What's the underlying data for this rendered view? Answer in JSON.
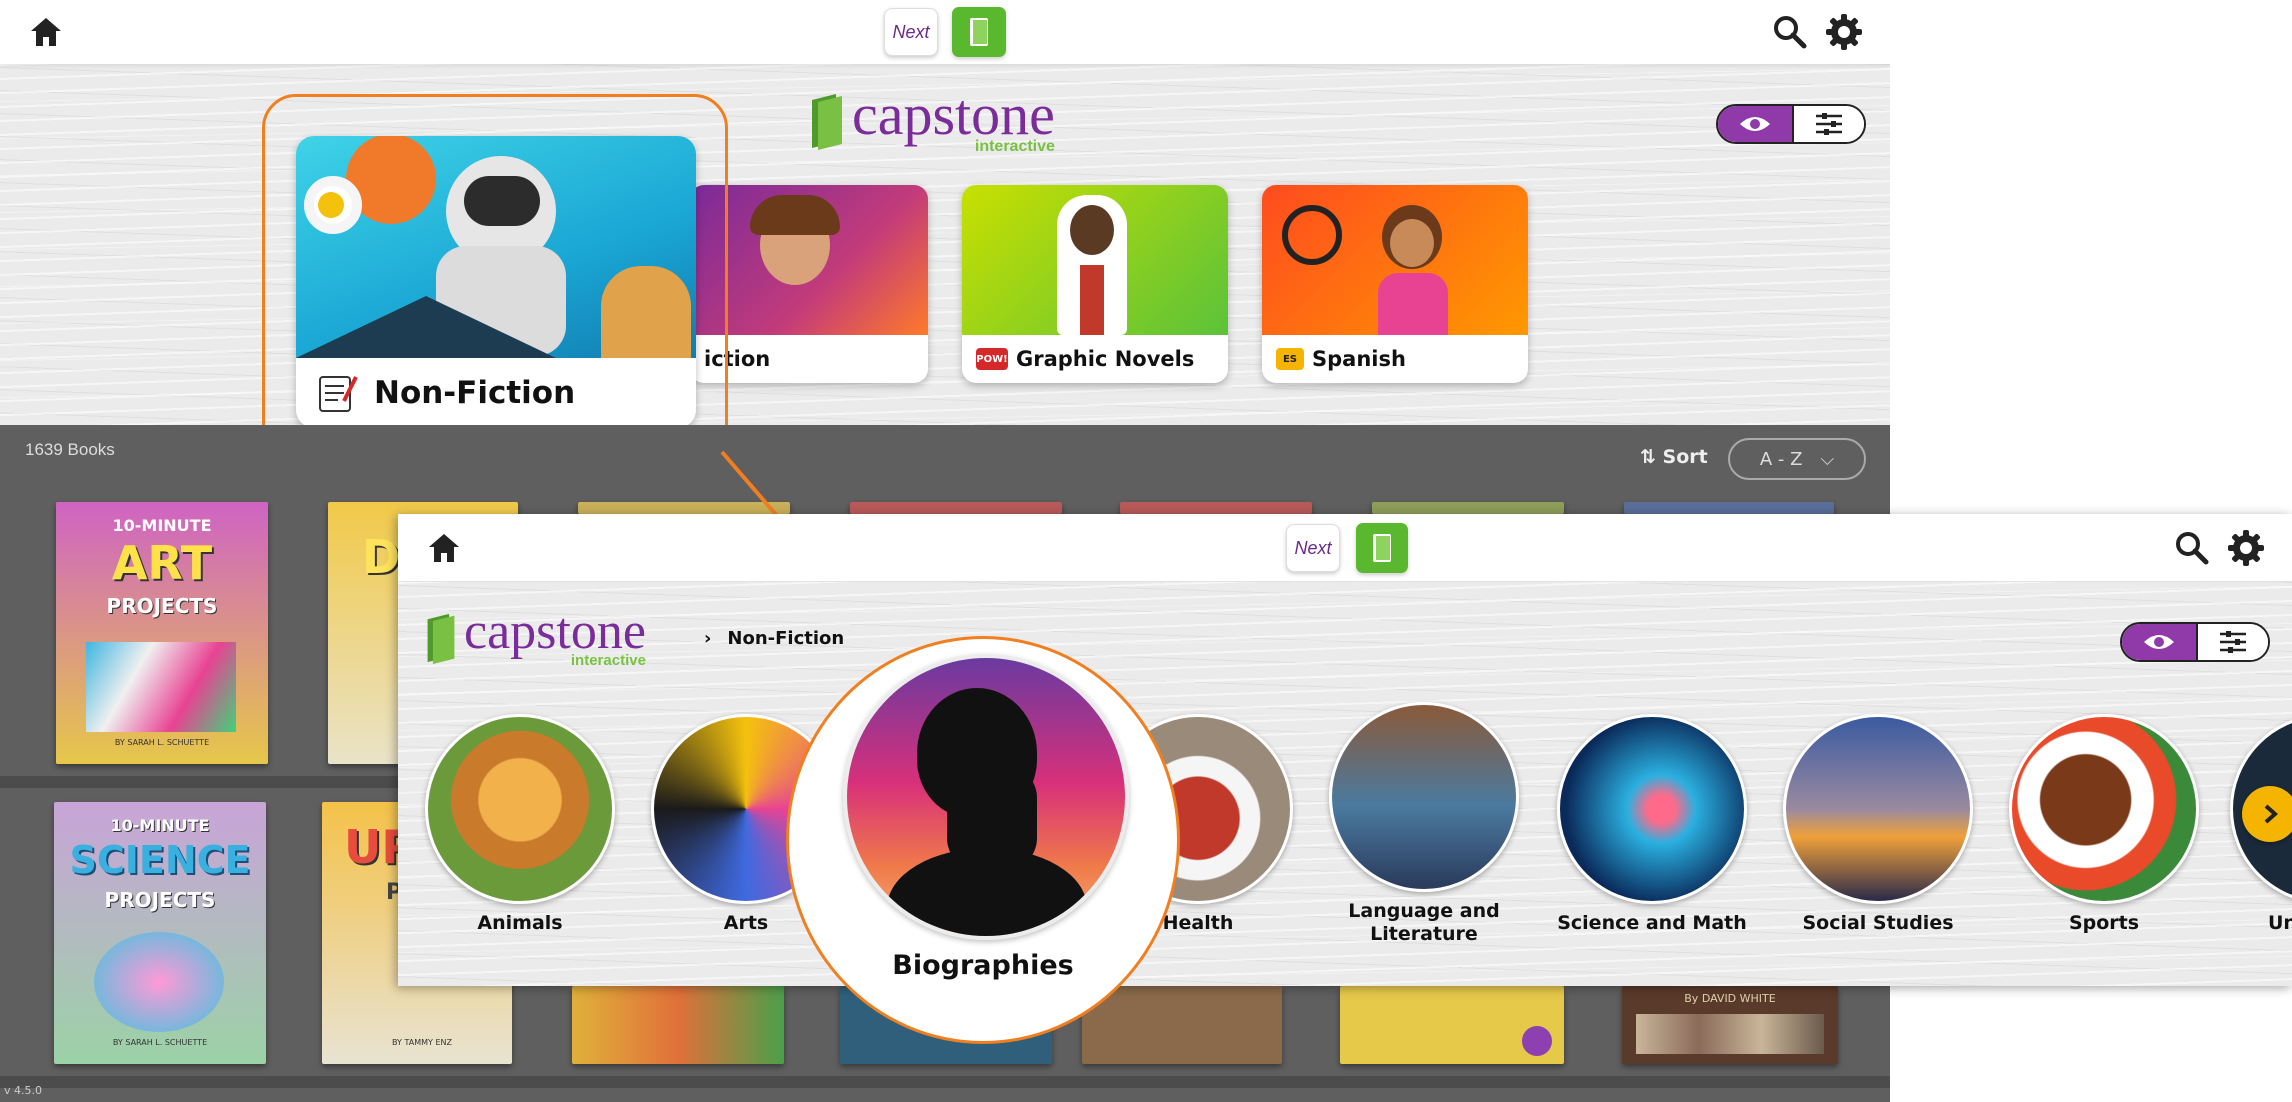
{
  "background_screen": {
    "next_label": "Next",
    "logo": {
      "word": "capstone",
      "sub": "interactive"
    },
    "categories": [
      {
        "label": "Non-Fiction",
        "icon": "scroll-icon"
      },
      {
        "label": "iction",
        "icon": ""
      },
      {
        "label": "Graphic Novels",
        "icon": "pow-badge",
        "badge": "POW!"
      },
      {
        "label": "Spanish",
        "icon": "es-badge",
        "badge": "ES"
      }
    ],
    "book_count": "1639 Books",
    "sort_label": "Sort",
    "sort_value": "A - Z",
    "version": "v 4.5.0",
    "books": [
      {
        "line1": "10-MINUTE",
        "line2": "ART",
        "line3": "PROJECTS",
        "author": "BY SARAH L. SCHUETTE"
      },
      {
        "line1": "10-MINUTE",
        "line2": "SCIENCE",
        "line3": "PROJECTS",
        "author": "BY SARAH L. SCHUETTE"
      },
      {
        "line1": "",
        "line2": "DR",
        "line3": "P"
      },
      {
        "line1": "",
        "line2": "UPC",
        "line3": "P",
        "author": "BY TAMMY ENZ"
      }
    ],
    "bottom_book_author": "By DAVID WHITE"
  },
  "foreground_screen": {
    "next_label": "Next",
    "logo": {
      "word": "capstone",
      "sub": "interactive"
    },
    "breadcrumb": "Non-Fiction",
    "subcategories": [
      {
        "label": "Animals"
      },
      {
        "label": "Arts"
      },
      {
        "label": "Biographies"
      },
      {
        "label": "Health"
      },
      {
        "label": "Language and Literature"
      },
      {
        "label": "Science and Math"
      },
      {
        "label": "Social Studies"
      },
      {
        "label": "Sports"
      },
      {
        "label": "Un"
      }
    ]
  },
  "colors": {
    "accent_orange": "#f07f21",
    "brand_purple": "#7a2d9a",
    "brand_green": "#5ab82f",
    "arrow_yellow": "#f4b400"
  }
}
